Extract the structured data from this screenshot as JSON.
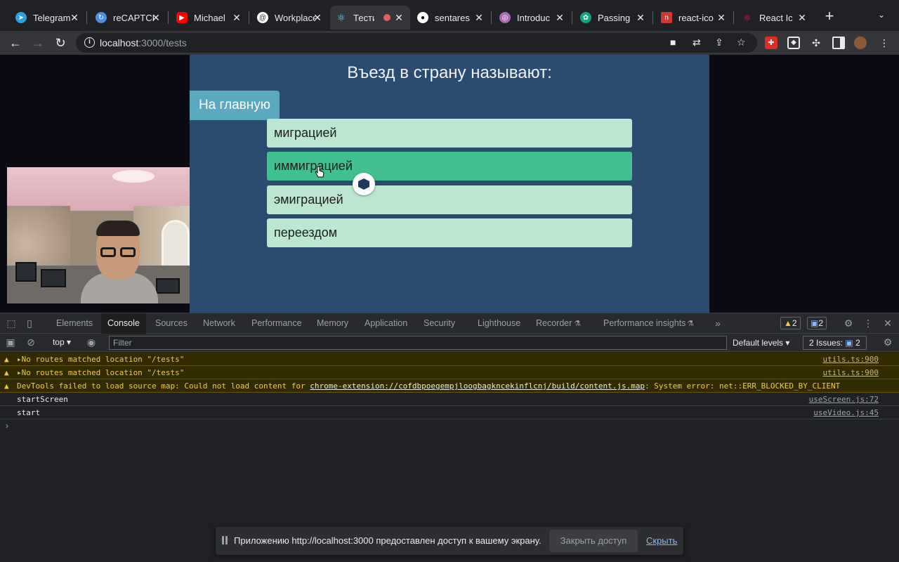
{
  "browser": {
    "tabs": [
      {
        "title": "Telegram",
        "favicon": "telegram-icon",
        "color": "#2aa3df"
      },
      {
        "title": "reCAPTCHA",
        "favicon": "recaptcha-icon",
        "color": "#4a90e2"
      },
      {
        "title": "Michael",
        "favicon": "youtube-icon",
        "color": "#ff0000"
      },
      {
        "title": "Workplace",
        "favicon": "workplace-icon",
        "color": "#ffffff"
      },
      {
        "title": "Тести",
        "favicon": "react-icon",
        "color": "#61dafb",
        "active": true,
        "recording": true
      },
      {
        "title": "sentares",
        "favicon": "github-icon",
        "color": "#ffffff"
      },
      {
        "title": "Introduc",
        "favicon": "globe-icon",
        "color": "#b06ab3"
      },
      {
        "title": "Passing",
        "favicon": "openai-icon",
        "color": "#10a37f"
      },
      {
        "title": "react-ico",
        "favicon": "npm-icon",
        "color": "#cb3837"
      },
      {
        "title": "React Ic",
        "favicon": "react-icons-icon",
        "color": "#e91e63"
      }
    ],
    "url_host": "localhost",
    "url_path": ":3000/tests"
  },
  "quiz": {
    "question": "Въезд в страну называют:",
    "home_button": "На главную",
    "answers": [
      {
        "label": "миграцией",
        "hovered": false
      },
      {
        "label": "иммиграцией",
        "hovered": true
      },
      {
        "label": "эмиграцией",
        "hovered": false
      },
      {
        "label": "переездом",
        "hovered": false
      }
    ]
  },
  "devtools": {
    "tabs": [
      "Elements",
      "Console",
      "Sources",
      "Network",
      "Performance",
      "Memory",
      "Application",
      "Security",
      "Lighthouse",
      "Recorder",
      "Performance insights"
    ],
    "active_tab": "Console",
    "warnings_count": "2",
    "messages_count": "2",
    "context": "top",
    "filter_placeholder": "Filter",
    "levels": "Default levels",
    "issues_label": "2 Issues:",
    "issues_count": "2",
    "console": [
      {
        "type": "warn",
        "text": "▸No routes matched location \"/tests\"",
        "source": "utils.ts:900"
      },
      {
        "type": "warn",
        "text": "▸No routes matched location \"/tests\"",
        "source": "utils.ts:900"
      },
      {
        "type": "warn",
        "text_before": "DevTools failed to load source map: Could not load content for ",
        "link": "chrome-extension://cofdbpoegempjloogbagkncekinflcnj/build/content.js.map",
        "text_after": ": System error: net::ERR_BLOCKED_BY_CLIENT",
        "source": ""
      },
      {
        "type": "info",
        "text": "startScreen",
        "source": "useScreen.js:72"
      },
      {
        "type": "info",
        "text": "start",
        "source": "useVideo.js:45"
      }
    ]
  },
  "share_bar": {
    "text": "Приложению http://localhost:3000 предоставлен доступ к вашему экрану.",
    "stop_label": "Закрыть доступ",
    "hide_label": "Скрыть"
  }
}
